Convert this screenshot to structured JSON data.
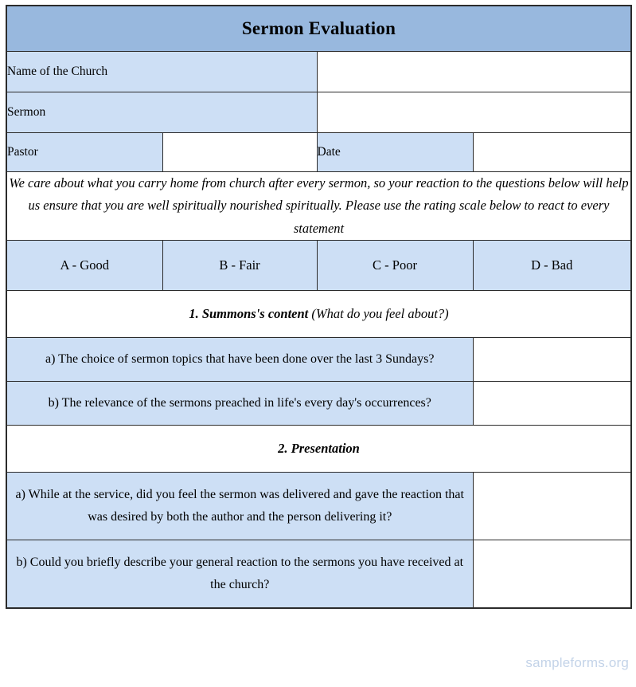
{
  "document": {
    "title": "Sermon Evaluation",
    "watermark": "sampleforms.org"
  },
  "colors": {
    "title_background": "#98b8de",
    "cell_background": "#cddff5",
    "border": "#2b2b2b",
    "watermark_text": "#c3d3e8",
    "page_background": "#ffffff"
  },
  "fields": [
    {
      "label": "Name of the Church",
      "value": ""
    },
    {
      "label": "Sermon",
      "value": ""
    }
  ],
  "inline_fields": [
    {
      "label": "Pastor",
      "value": ""
    },
    {
      "label": "Date",
      "value": ""
    }
  ],
  "instructions": "We care about what you carry home from church after every sermon, so your reaction to the questions below will help us ensure that you are well spiritually nourished spiritually. Please use the rating scale below to react to every statement",
  "rating_scale": [
    "A - Good",
    "B - Fair",
    "C - Poor",
    "D - Bad"
  ],
  "sections": [
    {
      "heading_number": "1. Summons's content",
      "heading_note": "(What do you feel about?)",
      "questions": [
        {
          "text": "a) The choice of sermon topics that have been done over the last 3 Sundays?",
          "answer": ""
        },
        {
          "text": "b) The relevance of the sermons preached in life's every day's occurrences?",
          "answer": ""
        }
      ]
    },
    {
      "heading_number": "2. Presentation",
      "heading_note": "",
      "questions": [
        {
          "text": "a) While at the service, did you feel the sermon was delivered and gave the reaction that was desired by both the author and the person delivering it?",
          "answer": ""
        },
        {
          "text": "b) Could you briefly describe your general reaction to the sermons you have received at the church?",
          "answer": ""
        }
      ]
    }
  ]
}
